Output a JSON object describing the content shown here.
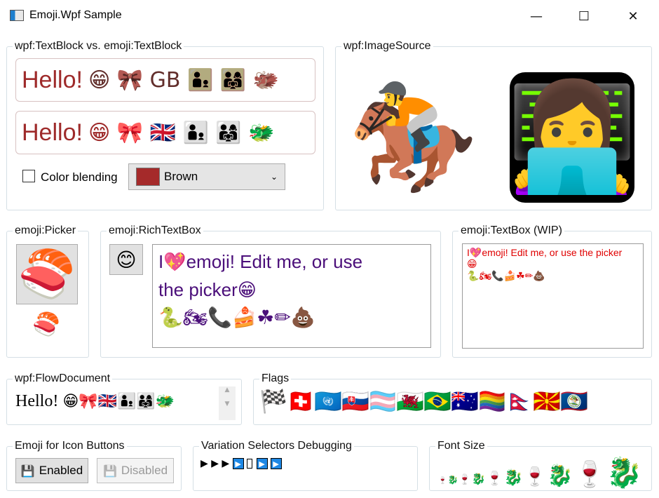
{
  "window": {
    "title": "Emoji.Wpf Sample",
    "minimize": "—",
    "maximize": "☐",
    "close": "✕"
  },
  "textblock_group": {
    "label": "wpf:TextBlock vs. emoji:TextBlock",
    "wpf_text": "Hello!",
    "wpf_emojis": "😁 🎀 GB 👨‍👦 👨‍👩‍👧 🐲",
    "emoji_text": "Hello!",
    "emoji_emojis": "😁 🎀 🇬🇧 👨‍👦 👨‍👩‍👧 🐲",
    "color_blending_label": "Color blending",
    "color_combo_value": "Brown",
    "colors": {
      "brown": "#a52a2a"
    }
  },
  "imagesource_group": {
    "label": "wpf:ImageSource",
    "image1": "🏇",
    "image2": "👩‍💻"
  },
  "picker_group": {
    "label": "emoji:Picker",
    "picker_emoji": "🍣",
    "small_emoji": "🍣"
  },
  "richtextbox_group": {
    "label": "emoji:RichTextBox",
    "button_emoji": "😊",
    "line1": "I💖emoji! Edit me, or use",
    "line2": "the picker😁",
    "line3": "🐍🏍📞🍰☘✏💩"
  },
  "textbox_group": {
    "label": "emoji:TextBox (WIP)",
    "line1": "I💖emoji! Edit me, or use the picker",
    "line2": "😁",
    "line3": "🐍🏍📞🍰☘✏💩"
  },
  "flowdocument_group": {
    "label": "wpf:FlowDocument",
    "text": "Hello!",
    "emojis": "😁🎀🇬🇧👨‍👦👨‍👩‍👧🐲"
  },
  "flags_group": {
    "label": "Flags",
    "flags": [
      "🏁",
      "🇨🇭",
      "🇺🇳",
      "🇸🇰",
      "🏳️‍⚧️",
      "🏴󠁧󠁢󠁷󠁬󠁳󠁿",
      "🇧🇷",
      "🇦🇺",
      "🏳️‍🌈",
      "🇳🇵",
      "🇲🇰",
      "🇧🇿"
    ]
  },
  "iconbuttons_group": {
    "label": "Emoji for Icon Buttons",
    "enabled_label": "Enabled",
    "disabled_label": "Disabled",
    "icon": "💾"
  },
  "variation_group": {
    "label": "Variation Selectors Debugging",
    "text": "▶ ▶ ▶"
  },
  "fontsize_group": {
    "label": "Font Size",
    "emojis": [
      "🍷",
      "🐉"
    ]
  }
}
